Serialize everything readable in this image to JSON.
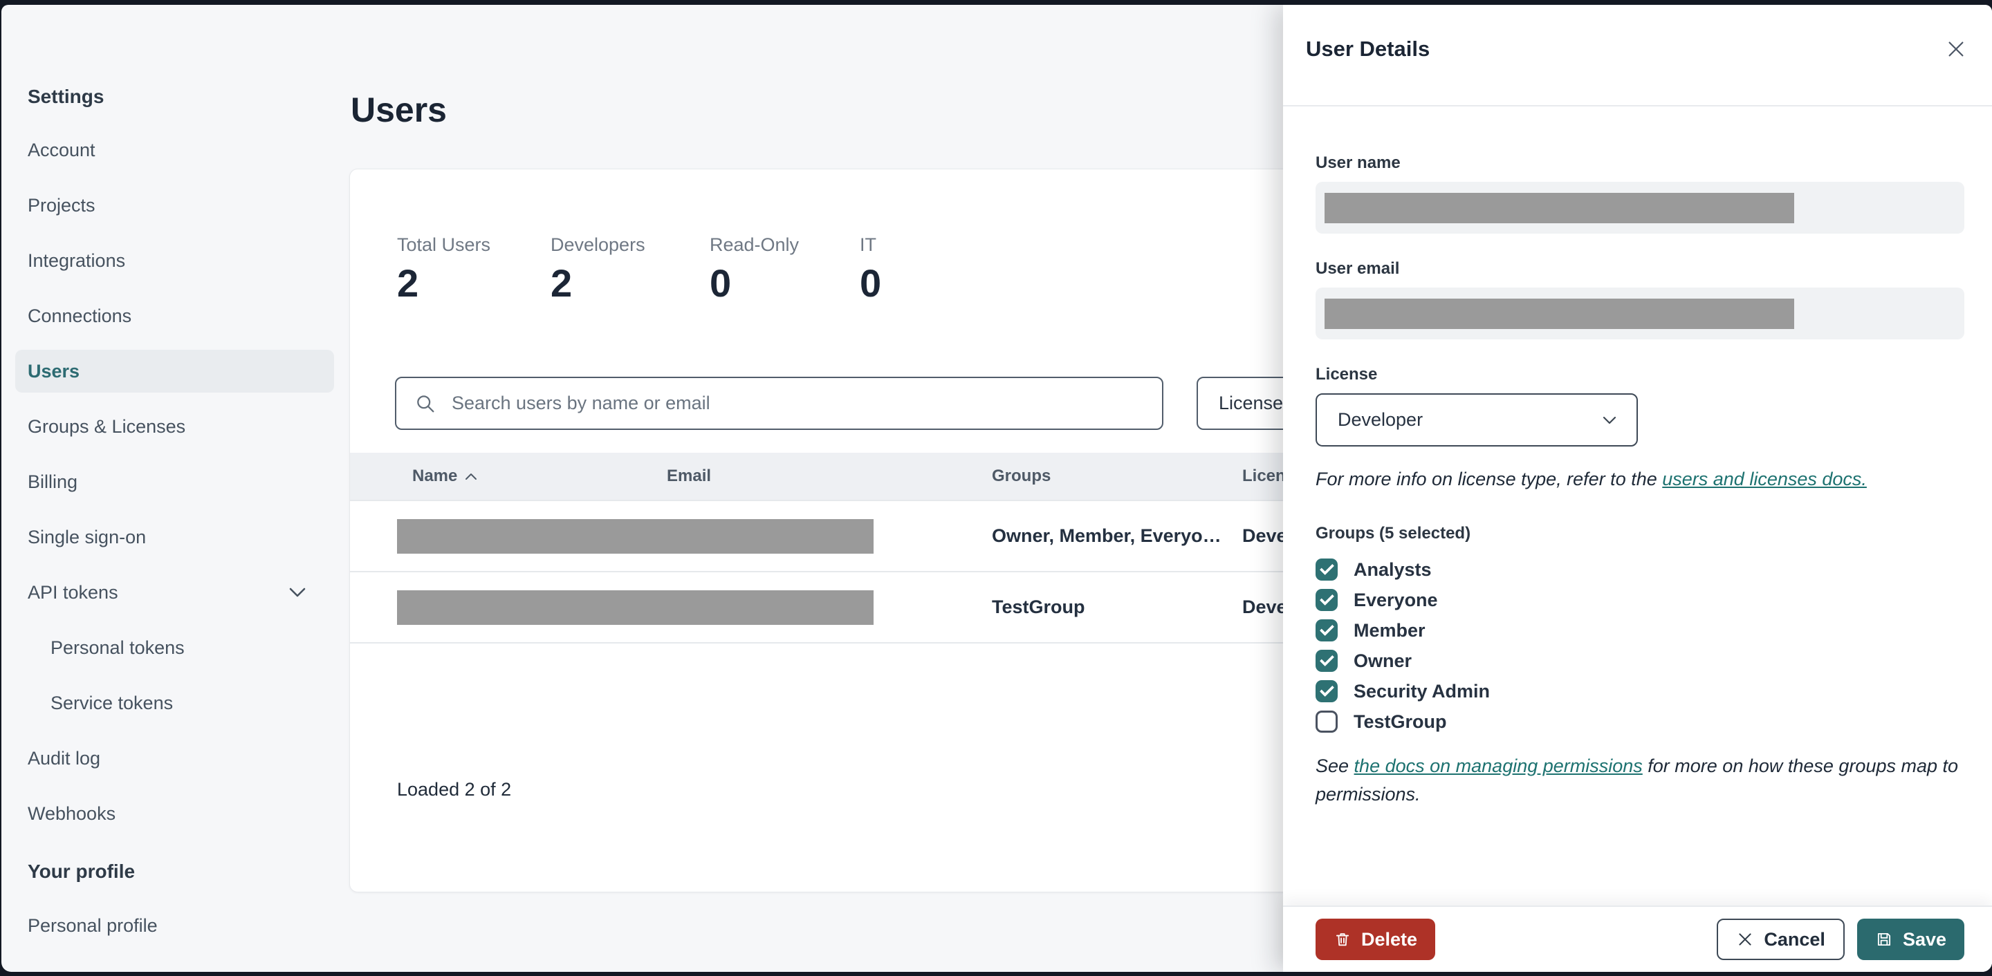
{
  "sidebar": {
    "section_header": "Settings",
    "items": [
      {
        "label": "Account"
      },
      {
        "label": "Projects"
      },
      {
        "label": "Integrations"
      },
      {
        "label": "Connections"
      },
      {
        "label": "Users",
        "active": true
      },
      {
        "label": "Groups & Licenses"
      },
      {
        "label": "Billing"
      },
      {
        "label": "Single sign-on"
      },
      {
        "label": "API tokens",
        "expandable": true
      },
      {
        "label": "Personal tokens",
        "indented": true
      },
      {
        "label": "Service tokens",
        "indented": true
      },
      {
        "label": "Audit log"
      },
      {
        "label": "Webhooks"
      }
    ],
    "profile_header": "Your profile",
    "profile_items": [
      {
        "label": "Personal profile"
      }
    ]
  },
  "main": {
    "title": "Users",
    "stats": [
      {
        "label": "Total Users",
        "value": "2"
      },
      {
        "label": "Developers",
        "value": "2"
      },
      {
        "label": "Read-Only",
        "value": "0"
      },
      {
        "label": "IT",
        "value": "0"
      }
    ],
    "search": {
      "placeholder": "Search users by name or email"
    },
    "license_filter_label": "License",
    "table": {
      "columns": [
        "Name",
        "Email",
        "Groups",
        "License"
      ],
      "sorted_column": "Name",
      "sort_direction": "asc",
      "rows": [
        {
          "name_redacted": true,
          "email_redacted": true,
          "groups": "Owner, Member, Everyo…",
          "license": "Developer"
        },
        {
          "name_redacted": true,
          "email_redacted": true,
          "groups": "TestGroup",
          "license": "Developer"
        }
      ]
    },
    "loaded_text": "Loaded 2 of 2"
  },
  "panel": {
    "title": "User Details",
    "user_name_label": "User name",
    "user_email_label": "User email",
    "license_label": "License",
    "license_value": "Developer",
    "license_note_prefix": "For more info on license type, refer to the ",
    "license_note_link": "users and licenses docs.",
    "groups_label": "Groups (5 selected)",
    "groups": [
      {
        "label": "Analysts",
        "checked": true
      },
      {
        "label": "Everyone",
        "checked": true
      },
      {
        "label": "Member",
        "checked": true
      },
      {
        "label": "Owner",
        "checked": true
      },
      {
        "label": "Security Admin",
        "checked": true
      },
      {
        "label": "TestGroup",
        "checked": false
      }
    ],
    "permissions_note_prefix": "See ",
    "permissions_note_link": "the docs on managing permissions",
    "permissions_note_suffix": " for more on how these groups map to permissions.",
    "buttons": {
      "delete": "Delete",
      "cancel": "Cancel",
      "save": "Save"
    }
  },
  "icons": {
    "search-icon": "magnifier",
    "sort-asc-icon": "chevron-up",
    "chevron-down-icon": "chevron-down",
    "close-icon": "x",
    "trash-icon": "trash-can",
    "x-icon": "x",
    "save-icon": "floppy-disk",
    "checkmark-icon": "check"
  },
  "colors": {
    "frame_dark": "#131823",
    "page_bg": "#f6f7f9",
    "accent_teal": "#2e7173",
    "link_teal": "#1d7270",
    "delete_red": "#ae3227",
    "save_teal": "#2b6a6e",
    "text_dark": "#1b2534",
    "text_muted": "#6f7884",
    "redacted_gray": "#9a9a9a"
  }
}
